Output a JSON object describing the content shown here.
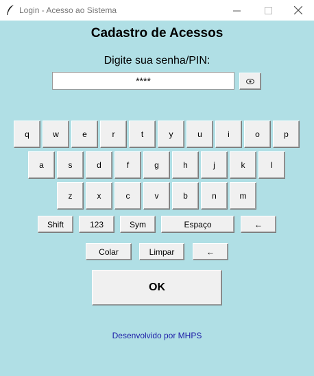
{
  "window": {
    "title": "Login - Acesso ao Sistema",
    "minimize_glyph": "—",
    "maximize_glyph": "☐",
    "close_glyph": "✕"
  },
  "heading": "Cadastro de Acessos",
  "prompt": "Digite sua senha/PIN:",
  "pin": {
    "value": "****",
    "toggle_icon": "eye-icon",
    "toggle_glyph": "👁"
  },
  "keyboard": {
    "row1": [
      "q",
      "w",
      "e",
      "r",
      "t",
      "y",
      "u",
      "i",
      "o",
      "p"
    ],
    "row2": [
      "a",
      "s",
      "d",
      "f",
      "g",
      "h",
      "j",
      "k",
      "l"
    ],
    "row3": [
      "z",
      "x",
      "c",
      "v",
      "b",
      "n",
      "m"
    ],
    "shift": "Shift",
    "numbers": "123",
    "symbols": "Sym",
    "space": "Espaço",
    "backspace": "←",
    "paste": "Colar",
    "clear": "Limpar",
    "backspace2": "←"
  },
  "ok_label": "OK",
  "footer": "Desenvolvido por MHPS",
  "colors": {
    "background": "#b0dfe5",
    "footer_text": "#1a1aa6",
    "button": "#f0f0f0"
  }
}
